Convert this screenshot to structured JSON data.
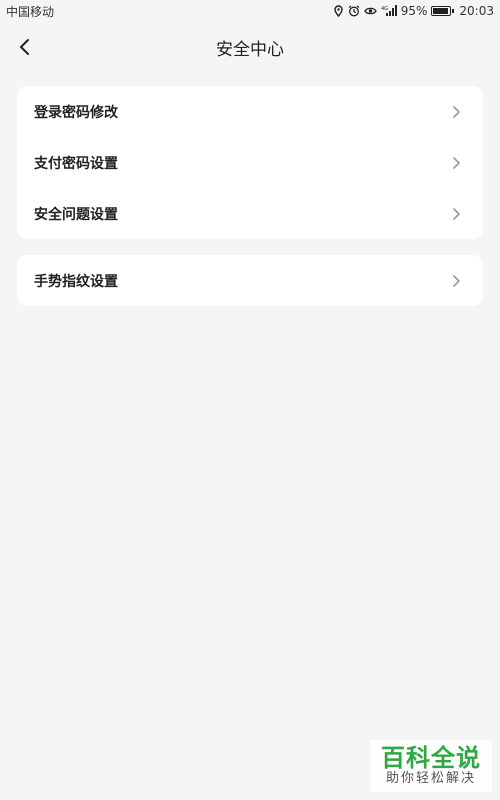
{
  "status_bar": {
    "carrier": "中国移动",
    "battery_percent": "95%",
    "battery_level": 0.95,
    "time": "20:03",
    "icons": [
      "location-icon",
      "alarm-icon",
      "eye-icon",
      "signal-4g-icon",
      "battery-icon"
    ]
  },
  "header": {
    "title": "安全中心",
    "back_icon": "chevron-left-icon"
  },
  "groups": [
    {
      "items": [
        {
          "label": "登录密码修改"
        },
        {
          "label": "支付密码设置"
        },
        {
          "label": "安全问题设置"
        }
      ]
    },
    {
      "items": [
        {
          "label": "手势指纹设置"
        }
      ]
    }
  ],
  "watermark": {
    "main": "百科全说",
    "sub": "助你轻松解决"
  },
  "colors": {
    "background": "#f5f5f5",
    "card": "#ffffff",
    "watermark_green": "#2ea844"
  }
}
